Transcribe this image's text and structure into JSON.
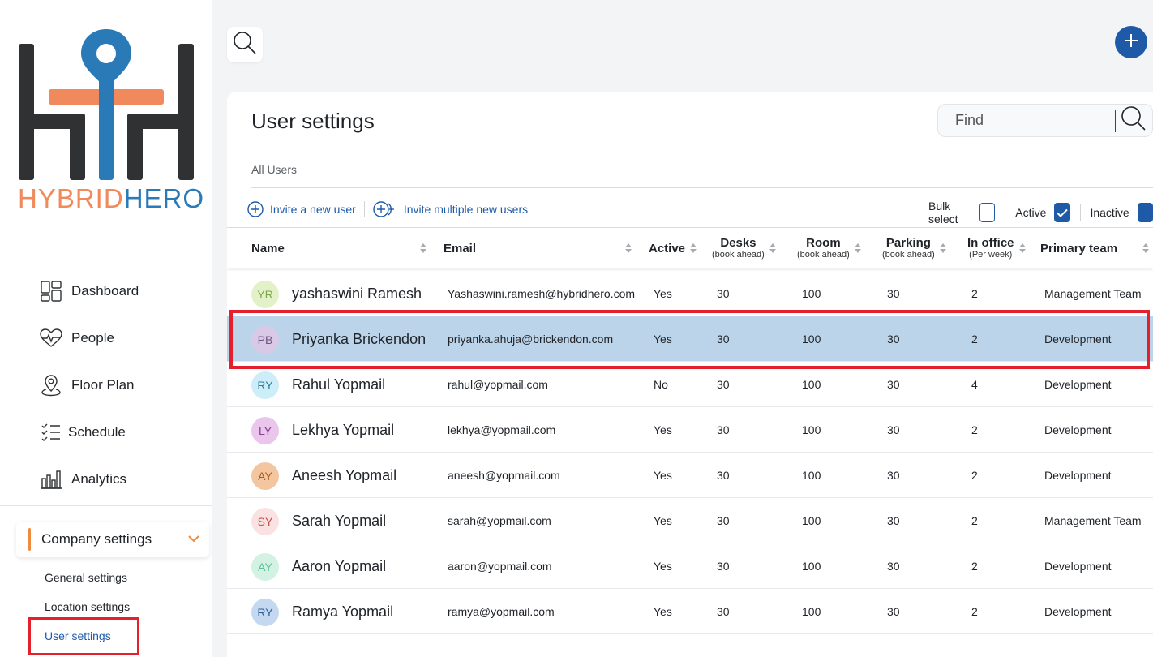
{
  "brand": {
    "word_part1": "HYBRID",
    "word_part2": "HERO",
    "color_orange": "#f08a5d",
    "color_blue": "#2a7ab8"
  },
  "sidebar": {
    "items": [
      {
        "label": "Dashboard",
        "icon": "dashboard-icon"
      },
      {
        "label": "People",
        "icon": "people-heart-icon"
      },
      {
        "label": "Floor Plan",
        "icon": "location-pin-icon"
      },
      {
        "label": "Schedule",
        "icon": "checklist-icon"
      },
      {
        "label": "Analytics",
        "icon": "bar-chart-icon"
      }
    ],
    "company_settings": "Company settings",
    "sub_items": [
      "General settings",
      "Location settings",
      "User settings"
    ],
    "active_sub_item": "User settings"
  },
  "panel": {
    "title": "User settings",
    "find_placeholder": "Find",
    "breadcrumb": "All Users",
    "invite_new": "Invite a new user",
    "invite_multiple": "Invite multiple new users",
    "bulk_select": "Bulk select",
    "active_label": "Active",
    "inactive_label": "Inactive",
    "bulk_checked": false,
    "active_checked": true,
    "inactive_checked": true
  },
  "table": {
    "headers": {
      "name": "Name",
      "email": "Email",
      "active": "Active",
      "desks": "Desks",
      "desks_sub": "(book ahead)",
      "room": "Room",
      "room_sub": "(book ahead)",
      "parking": "Parking",
      "parking_sub": "(book ahead)",
      "office": "In office",
      "office_sub": "(Per week)",
      "team": "Primary team"
    },
    "rows": [
      {
        "initials": "YR",
        "name": "yashaswini Ramesh",
        "email": "Yashaswini.ramesh@hybridhero.com",
        "active": "Yes",
        "desks": "30",
        "room": "100",
        "parking": "30",
        "office": "2",
        "team": "Management Team",
        "avatar_bg": "#e3f1c9",
        "avatar_fg": "#7fa64a",
        "selected": false
      },
      {
        "initials": "PB",
        "name": "Priyanka Brickendon",
        "email": "priyanka.ahuja@brickendon.com",
        "active": "Yes",
        "desks": "30",
        "room": "100",
        "parking": "30",
        "office": "2",
        "team": "Development",
        "avatar_bg": "#d9c9e6",
        "avatar_fg": "#6b5580",
        "selected": true
      },
      {
        "initials": "RY",
        "name": "Rahul Yopmail",
        "email": "rahul@yopmail.com",
        "active": "No",
        "desks": "30",
        "room": "100",
        "parking": "30",
        "office": "4",
        "team": "Development",
        "avatar_bg": "#cdeef8",
        "avatar_fg": "#2f7f9c",
        "selected": false
      },
      {
        "initials": "LY",
        "name": "Lekhya Yopmail",
        "email": "lekhya@yopmail.com",
        "active": "Yes",
        "desks": "30",
        "room": "100",
        "parking": "30",
        "office": "2",
        "team": "Development",
        "avatar_bg": "#eac5ec",
        "avatar_fg": "#8a3f8f",
        "selected": false
      },
      {
        "initials": "AY",
        "name": "Aneesh Yopmail",
        "email": "aneesh@yopmail.com",
        "active": "Yes",
        "desks": "30",
        "room": "100",
        "parking": "30",
        "office": "2",
        "team": "Development",
        "avatar_bg": "#f3c6a0",
        "avatar_fg": "#a85a1e",
        "selected": false
      },
      {
        "initials": "SY",
        "name": "Sarah Yopmail",
        "email": "sarah@yopmail.com",
        "active": "Yes",
        "desks": "30",
        "room": "100",
        "parking": "30",
        "office": "2",
        "team": "Management Team",
        "avatar_bg": "#fbe2e2",
        "avatar_fg": "#c0504d",
        "selected": false
      },
      {
        "initials": "AY",
        "name": "Aaron Yopmail",
        "email": "aaron@yopmail.com",
        "active": "Yes",
        "desks": "30",
        "room": "100",
        "parking": "30",
        "office": "2",
        "team": "Development",
        "avatar_bg": "#d3f2e3",
        "avatar_fg": "#5cc295",
        "selected": false
      },
      {
        "initials": "RY",
        "name": "Ramya Yopmail",
        "email": "ramya@yopmail.com",
        "active": "Yes",
        "desks": "30",
        "room": "100",
        "parking": "30",
        "office": "2",
        "team": "Development",
        "avatar_bg": "#c4d9f0",
        "avatar_fg": "#2f5f9a",
        "selected": false
      }
    ]
  },
  "colors": {
    "accent_blue": "#1f5aa8",
    "highlight_row": "#bcd4ea",
    "annotation_red": "#e3202b",
    "accent_orange": "#f08a3c"
  }
}
